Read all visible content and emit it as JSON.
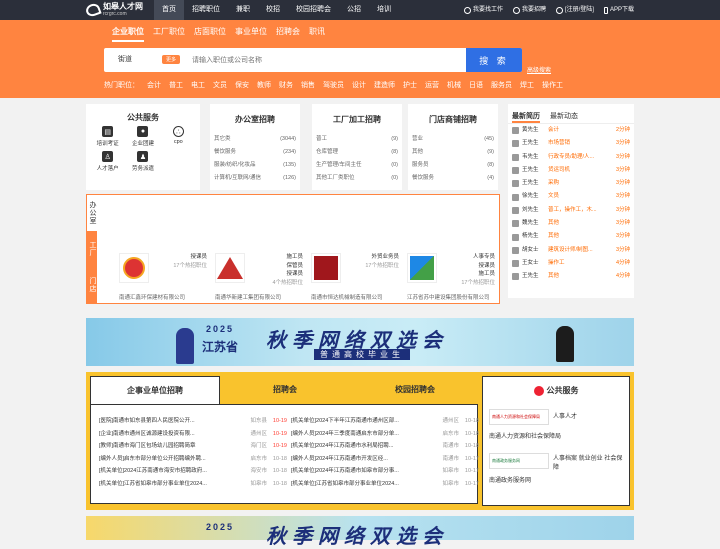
{
  "topbar": {
    "logo_cn": "如皋人才网",
    "logo_en": "rcrgrc.com",
    "nav": [
      "首页",
      "招聘职位",
      "兼职",
      "校招",
      "校园招聘会",
      "公招",
      "培训"
    ],
    "right": [
      "我要找工作",
      "我要招聘",
      "[注册/登陆]",
      "APP下载"
    ]
  },
  "search": {
    "tabs": [
      "企业职位",
      "工厂职位",
      "店面职位",
      "事业单位",
      "招聘会",
      "职讯"
    ],
    "city": "街道",
    "change": "更多",
    "placeholder": "请输入职位或公司名称",
    "button": "搜 索",
    "advanced": "高级搜索",
    "hot": [
      "热门职位：",
      "会计",
      "普工",
      "电工",
      "文员",
      "保安",
      "教师",
      "财务",
      "销售",
      "驾驶员",
      "设计",
      "建造师",
      "护士",
      "运营",
      "机械",
      "日语",
      "服务员",
      "焊工",
      "操作工"
    ]
  },
  "public": {
    "title": "公共服务",
    "items": [
      "培训考证",
      "企业团建",
      "cpo",
      "人才落户",
      "劳务派遣"
    ]
  },
  "cats": [
    {
      "title": "办公室招聘",
      "rows": [
        [
          "其它类",
          "(3044)"
        ],
        [
          "餐饮服务",
          "(234)"
        ],
        [
          "服装/纺织/化妆品",
          "(135)"
        ],
        [
          "计算机/互联网/通信",
          "(126)"
        ]
      ]
    },
    {
      "title": "工厂加工招聘",
      "rows": [
        [
          "普工",
          "(9)"
        ],
        [
          "仓库管理",
          "(8)"
        ],
        [
          "生产管理/车间主任",
          "(0)"
        ],
        [
          "其他工厂类职位",
          "(0)"
        ]
      ]
    },
    {
      "title": "门店商铺招聘",
      "rows": [
        [
          "营业",
          "(45)"
        ],
        [
          "其他",
          "(9)"
        ],
        [
          "服务员",
          "(8)"
        ],
        [
          "餐饮服务",
          "(4)"
        ]
      ]
    }
  ],
  "resume": {
    "tabs": [
      "最新简历",
      "最新动态"
    ],
    "rows": [
      [
        "黄先生",
        "会计",
        "2分钟"
      ],
      [
        "王先生",
        "市场营销",
        "3分钟"
      ],
      [
        "韦先生",
        "行政专员/助理/人...",
        "3分钟"
      ],
      [
        "王先生",
        "货运司机",
        "3分钟"
      ],
      [
        "王先生",
        "采购",
        "3分钟"
      ],
      [
        "徐先生",
        "文员",
        "3分钟"
      ],
      [
        "刘先生",
        "普工，操作工，木...",
        "3分钟"
      ],
      [
        "魏先生",
        "其他",
        "3分钟"
      ],
      [
        "杨先生",
        "其他",
        "3分钟"
      ],
      [
        "胡女士",
        "建筑设计师/制图...",
        "3分钟"
      ],
      [
        "王女士",
        "操作工",
        "4分钟"
      ],
      [
        "王先生",
        "其他",
        "4分钟"
      ]
    ]
  },
  "featured": {
    "tabs": [
      "办公室",
      "工厂",
      "门店"
    ],
    "companies": [
      {
        "jobs": [
          "授课员",
          "17个热招职位"
        ],
        "name": "南通汇鑫环保建材有限公司"
      },
      {
        "jobs": [
          "施工员",
          "保管员",
          "授课员",
          "4个热招职位"
        ],
        "name": "南通华新建工集团有限公司"
      },
      {
        "jobs": [
          "外贸业务员",
          "17个热招职位"
        ],
        "name": "南通市恒达机械制造有限公司"
      },
      {
        "jobs": [
          "人事专员",
          "授课员",
          "施工员",
          "17个热招职位"
        ],
        "name": "江苏省苏中建设集团股份有限公司"
      }
    ]
  },
  "banner": {
    "year": "2025",
    "province": "江苏省",
    "title": "秋季网络双选会",
    "sub": "普通高校毕业生"
  },
  "notice": {
    "tabs": [
      "企事业单位招聘",
      "招聘会",
      "校园招聘会"
    ],
    "left": [
      [
        "[医院]南通市如东县第四人民医院公开...",
        "如东县",
        "10-19",
        true
      ],
      [
        "[企业]南通市通州区诚源建设投资有限...",
        "通州区",
        "10-19",
        true
      ],
      [
        "[教师]南通市海门区包场幼儿园招聘简章",
        "海门区",
        "10-19",
        true
      ],
      [
        "[编外人员]启东市部分单位公开招聘编外聘...",
        "启东市",
        "10-18",
        false
      ],
      [
        "[机关单位]2024江苏南通市海安市招聘政府...",
        "海安市",
        "10-18",
        false
      ],
      [
        "[机关单位]江苏省如皋市部分事业单位2024...",
        "如皋市",
        "10-18",
        false
      ]
    ],
    "right": [
      [
        "[机关单位]2024下半年江苏南通市通州区部...",
        "通州区",
        "10-18",
        false
      ],
      [
        "[编外人员]2024年三季度南通启东市部分单...",
        "启东市",
        "10-18",
        false
      ],
      [
        "[机关单位]2024年江苏南通市水利局招聘...",
        "南通市",
        "10-18",
        false
      ],
      [
        "[编外人员]2024年江苏南通市开发区经...",
        "南通市",
        "10-17",
        false
      ],
      [
        "[机关单位]2024年江苏南通市如皋市部分事...",
        "如皋市",
        "10-17",
        false
      ],
      [
        "[机关单位]江苏省如皋市部分事业单位2024...",
        "如皋市",
        "10-17",
        false
      ]
    ]
  },
  "service": {
    "title": "公共服务",
    "items": [
      {
        "img": "南通人力资源和社会保障局",
        "label": "人事人才",
        "cap": "南通人力资源和社会保障局"
      },
      {
        "img": "南通政务服务网",
        "label": "人事档案  就业创业  社会保障",
        "cap": "南通政务服务网"
      }
    ]
  }
}
